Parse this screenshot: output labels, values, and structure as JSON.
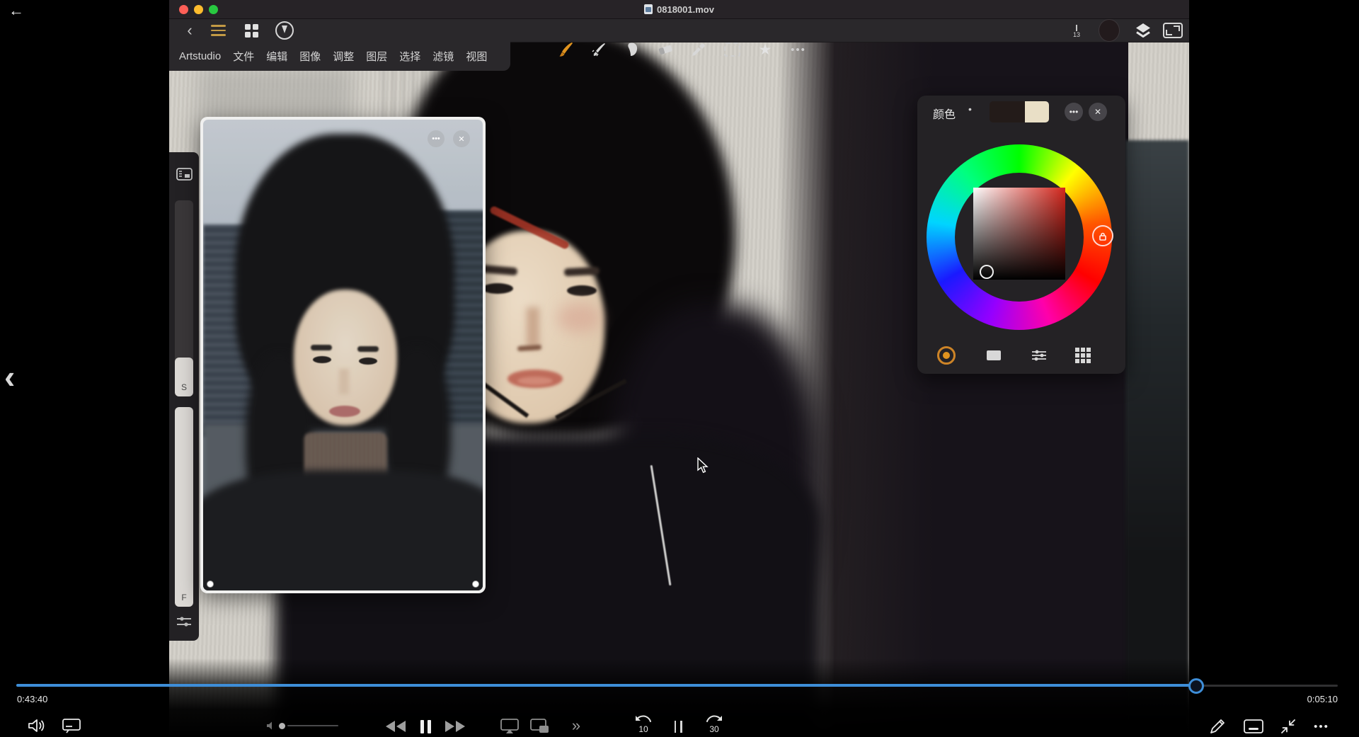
{
  "player": {
    "back_icon": "←",
    "prev_icon": "‹",
    "elapsed": "0:43:40",
    "remaining": "0:05:10",
    "progress_pct": 89.2,
    "accent_blue": "#3e8ed8",
    "skip_back_label": "10",
    "skip_forward_label": "30",
    "more_chevron": "»",
    "more_icon": "•••"
  },
  "window": {
    "title": "0818001.mov",
    "traffic_colors": {
      "close": "#ff5f57",
      "minimize": "#febc2e",
      "zoom": "#28c840"
    }
  },
  "menubar": {
    "items": [
      "Artstudio",
      "文件",
      "编辑",
      "图像",
      "调整",
      "图层",
      "选择",
      "滤镜",
      "视图"
    ]
  },
  "toolbar": {
    "back_icon": "‹",
    "star_icon": "★",
    "more_icon": "•••",
    "brush_size": "13",
    "active_tool": "brush",
    "active_tool_color": "#e0931f",
    "current_color": "#221a1c"
  },
  "sidebar": {
    "size_label": "S",
    "flow_label": "F"
  },
  "color_panel": {
    "title": "颜色",
    "title_dot": "•",
    "more_icon": "•••",
    "close_icon": "✕",
    "swatch_primary": "#231b19",
    "swatch_secondary": "#e9dfc6",
    "selected_hue": "red",
    "mode_active": "wheel",
    "mode_active_color": "#e0931f"
  },
  "reference_panel": {
    "more_icon": "•••",
    "close_icon": "✕"
  }
}
